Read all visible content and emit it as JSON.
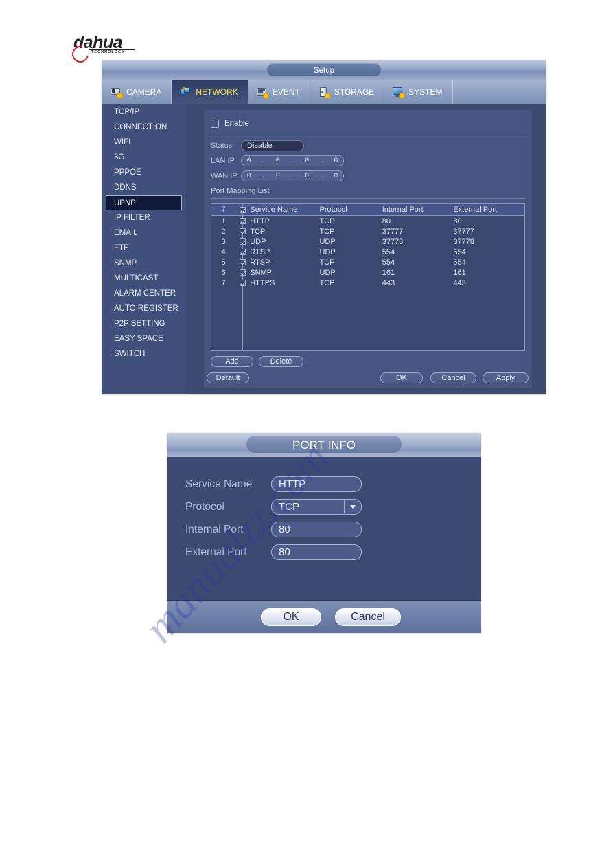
{
  "brand": {
    "name": "dahua",
    "sub": "TECHNOLOGY"
  },
  "window": {
    "title": "Setup",
    "tabs": [
      {
        "label": "CAMERA",
        "icon": "camera-icon",
        "active": false
      },
      {
        "label": "NETWORK",
        "icon": "network-icon",
        "active": true
      },
      {
        "label": "EVENT",
        "icon": "event-icon",
        "active": false
      },
      {
        "label": "STORAGE",
        "icon": "storage-icon",
        "active": false
      },
      {
        "label": "SYSTEM",
        "icon": "system-icon",
        "active": false
      }
    ]
  },
  "sidebar": {
    "items": [
      {
        "label": "TCP/IP",
        "active": false
      },
      {
        "label": "CONNECTION",
        "active": false
      },
      {
        "label": "WIFI",
        "active": false
      },
      {
        "label": "3G",
        "active": false
      },
      {
        "label": "PPPOE",
        "active": false
      },
      {
        "label": "DDNS",
        "active": false
      },
      {
        "label": "UPNP",
        "active": true
      },
      {
        "label": "IP FILTER",
        "active": false
      },
      {
        "label": "EMAIL",
        "active": false
      },
      {
        "label": "FTP",
        "active": false
      },
      {
        "label": "SNMP",
        "active": false
      },
      {
        "label": "MULTICAST",
        "active": false
      },
      {
        "label": "ALARM CENTER",
        "active": false
      },
      {
        "label": "AUTO REGISTER",
        "active": false
      },
      {
        "label": "P2P SETTING",
        "active": false
      },
      {
        "label": "EASY SPACE",
        "active": false
      },
      {
        "label": "SWITCH",
        "active": false
      }
    ]
  },
  "upnp": {
    "enable_label": "Enable",
    "enable_checked": false,
    "status_label": "Status",
    "status_value": "Disable",
    "lan_ip_label": "LAN IP",
    "lan_ip": [
      "0",
      "0",
      "0",
      "0"
    ],
    "wan_ip_label": "WAN IP",
    "wan_ip": [
      "0",
      "0",
      "0",
      "0"
    ],
    "port_mapping_label": "Port Mapping List",
    "table": {
      "count": "7",
      "headers": {
        "index": "7",
        "service_name": "Service Name",
        "protocol": "Protocol",
        "internal_port": "Internal Port",
        "external_port": "External Port"
      },
      "rows": [
        {
          "index": "1",
          "checked": true,
          "service_name": "HTTP",
          "protocol": "TCP",
          "internal_port": "80",
          "external_port": "80"
        },
        {
          "index": "2",
          "checked": true,
          "service_name": "TCP",
          "protocol": "TCP",
          "internal_port": "37777",
          "external_port": "37777"
        },
        {
          "index": "3",
          "checked": true,
          "service_name": "UDP",
          "protocol": "UDP",
          "internal_port": "37778",
          "external_port": "37778"
        },
        {
          "index": "4",
          "checked": true,
          "service_name": "RTSP",
          "protocol": "UDP",
          "internal_port": "554",
          "external_port": "554"
        },
        {
          "index": "5",
          "checked": true,
          "service_name": "RTSP",
          "protocol": "TCP",
          "internal_port": "554",
          "external_port": "554"
        },
        {
          "index": "6",
          "checked": true,
          "service_name": "SNMP",
          "protocol": "UDP",
          "internal_port": "161",
          "external_port": "161"
        },
        {
          "index": "7",
          "checked": true,
          "service_name": "HTTPS",
          "protocol": "TCP",
          "internal_port": "443",
          "external_port": "443"
        }
      ]
    },
    "buttons": {
      "add": "Add",
      "delete": "Delete",
      "default": "Default",
      "ok": "OK",
      "cancel": "Cancel",
      "apply": "Apply"
    }
  },
  "dialog": {
    "title": "PORT INFO",
    "fields": {
      "service_name_label": "Service Name",
      "service_name_value": "HTTP",
      "protocol_label": "Protocol",
      "protocol_value": "TCP",
      "internal_port_label": "Internal Port",
      "internal_port_value": "80",
      "external_port_label": "External Port",
      "external_port_value": "80"
    },
    "buttons": {
      "ok": "OK",
      "cancel": "Cancel"
    }
  },
  "watermark": {
    "text": "manualzz.com"
  },
  "colors": {
    "panel_bg": "#3b4a71",
    "content_bg": "#46557f",
    "sidebar_bg": "#41507a",
    "active_tab_text": "#ffe44b",
    "brand_red": "#d6232b"
  }
}
